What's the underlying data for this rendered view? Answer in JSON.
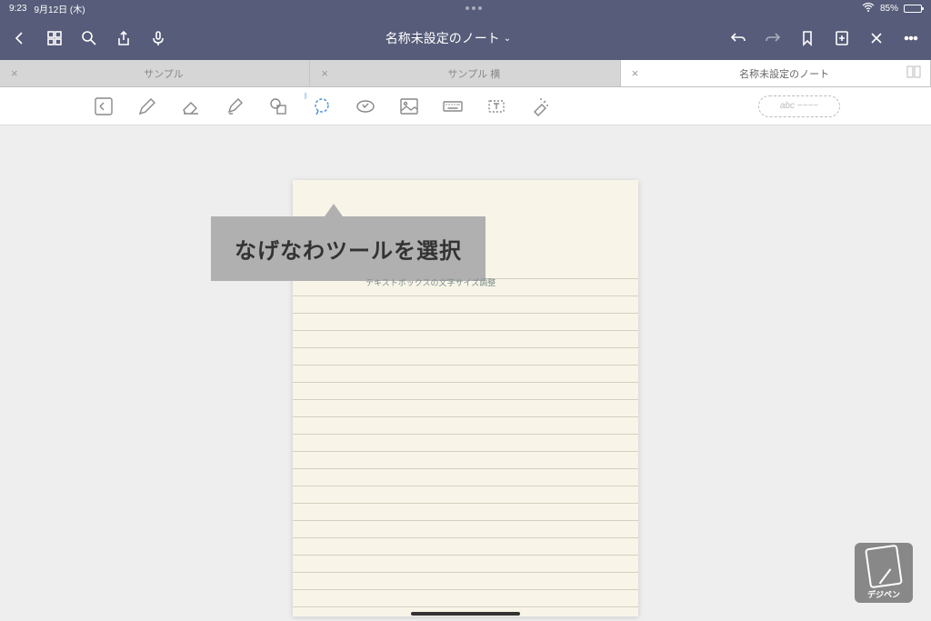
{
  "status": {
    "time": "9:23",
    "date": "9月12日 (木)",
    "battery": "85%"
  },
  "nav": {
    "title": "名称未設定のノート",
    "dropdown": "⌄"
  },
  "tabs": [
    {
      "label": "サンプル",
      "active": false
    },
    {
      "label": "サンプル 横",
      "active": false
    },
    {
      "label": "名称未設定のノート",
      "active": true
    }
  ],
  "ruler_hint": "abc ~~~~",
  "paper": {
    "textbox_note": "テキストボックスの文字サイズ調整"
  },
  "callout": "なげなわツールを選択",
  "watermark": "デジペン"
}
